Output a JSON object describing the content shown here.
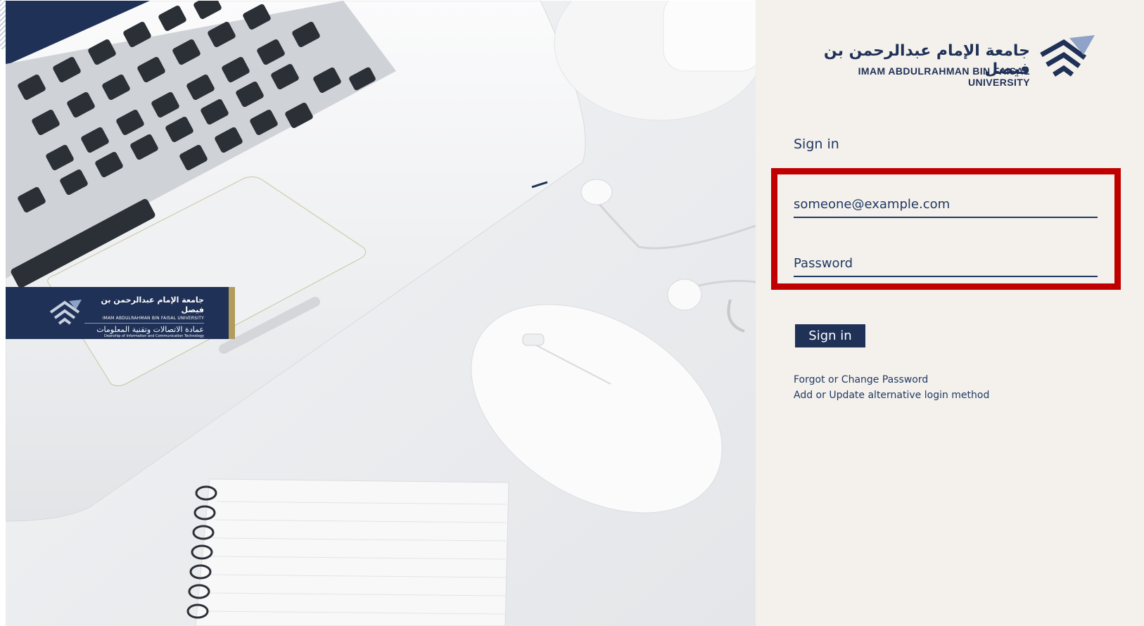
{
  "hero": {
    "badge": {
      "arabic_name": "جامعة الإمام عبدالرحمن بن فيصل",
      "english_name": "IMAM ABDULRAHMAN BIN FAISAL UNIVERSITY",
      "arabic_dept": "عمادة الاتصالات وتقنية المعلومات",
      "english_dept": "Deanship of Information and Communication Technology"
    }
  },
  "logo": {
    "arabic_name": "جامعة الإمام عبدالرحمن بن فيصل",
    "english_name": "IMAM ABDULRAHMAN BIN FAISAL UNIVERSITY"
  },
  "form": {
    "title": "Sign in",
    "email_placeholder": "someone@example.com",
    "password_placeholder": "Password",
    "submit_label": "Sign in"
  },
  "links": {
    "forgot": "Forgot or Change Password",
    "alternative": "Add or Update alternative login method"
  },
  "colors": {
    "brand_navy": "#1f3157",
    "highlight_red": "#c00000",
    "panel_bg": "#f4f1ec",
    "badge_gold": "#b39b5e"
  },
  "icons": {
    "university_emblem": "university-logo-icon"
  }
}
